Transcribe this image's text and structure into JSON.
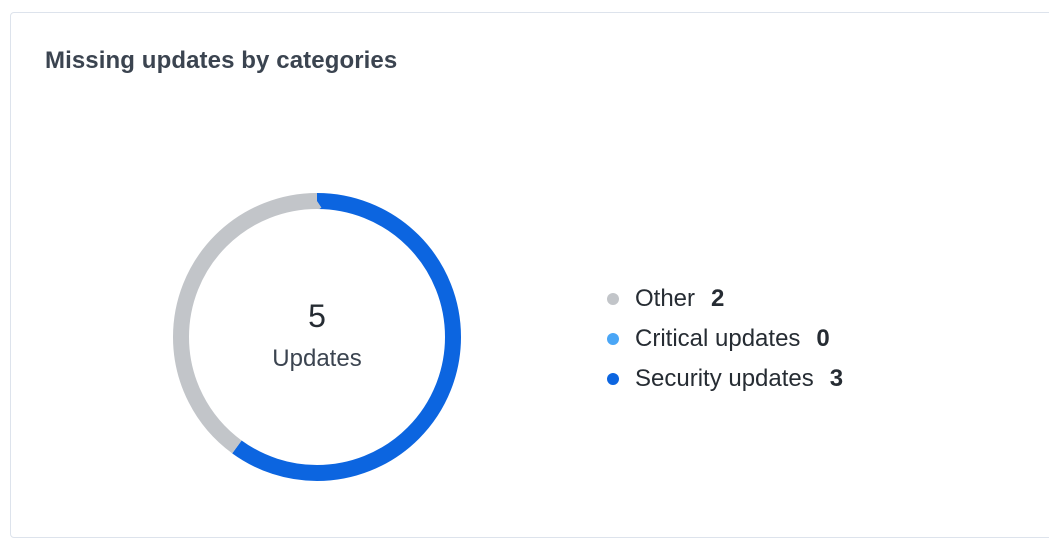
{
  "card": {
    "title": "Missing updates by categories"
  },
  "chart_data": {
    "type": "pie",
    "title": "Missing updates by categories",
    "center_value": "5",
    "center_label": "Updates",
    "legend_position": "right",
    "categories": [
      "Other",
      "Critical updates",
      "Security updates"
    ],
    "values": [
      2,
      0,
      3
    ],
    "colors": [
      "#c2c5c9",
      "#4aa6f6",
      "#0c65e0"
    ]
  }
}
